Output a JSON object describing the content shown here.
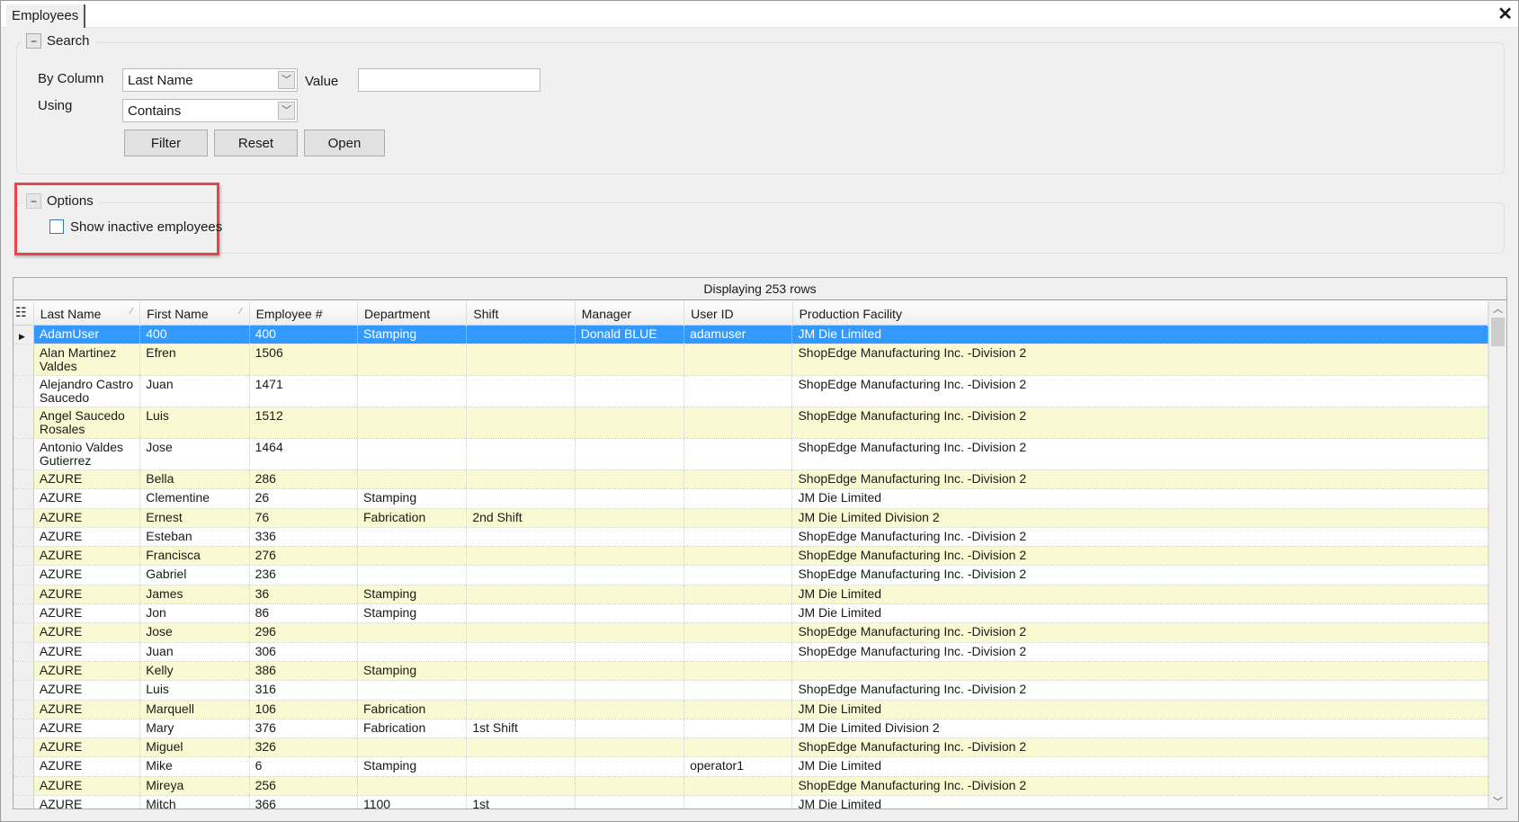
{
  "window": {
    "tab": "Employees",
    "close_icon": "close-icon"
  },
  "search": {
    "title": "Search",
    "by_column_label": "By Column",
    "by_column_value": "Last Name",
    "value_label": "Value",
    "value": "",
    "using_label": "Using",
    "using_value": "Contains",
    "filter": "Filter",
    "reset": "Reset",
    "open": "Open"
  },
  "options": {
    "title": "Options",
    "show_inactive": "Show inactive employees",
    "show_inactive_checked": false,
    "highlight_color": "#e8454a"
  },
  "grid": {
    "caption": "Displaying 253 rows",
    "columns": [
      "Last Name",
      "First Name",
      "Employee #",
      "Department",
      "Shift",
      "Manager",
      "User ID",
      "Production Facility"
    ],
    "selected_color": "#3399ff",
    "alt_row_color": "#fafad2",
    "rows": [
      [
        "AdamUser",
        "400",
        "400",
        "Stamping",
        "",
        "Donald BLUE",
        "adamuser",
        "JM Die Limited"
      ],
      [
        "Alan Martinez Valdes",
        "Efren",
        "1506",
        "",
        "",
        "",
        "",
        "ShopEdge Manufacturing Inc. -Division 2"
      ],
      [
        "Alejandro Castro Saucedo",
        "Juan",
        "1471",
        "",
        "",
        "",
        "",
        "ShopEdge Manufacturing Inc. -Division 2"
      ],
      [
        "Angel Saucedo Rosales",
        "Luis",
        "1512",
        "",
        "",
        "",
        "",
        "ShopEdge Manufacturing Inc. -Division 2"
      ],
      [
        "Antonio Valdes Gutierrez",
        "Jose",
        "1464",
        "",
        "",
        "",
        "",
        "ShopEdge Manufacturing Inc. -Division 2"
      ],
      [
        "AZURE",
        "Bella",
        "286",
        "",
        "",
        "",
        "",
        "ShopEdge Manufacturing Inc. -Division 2"
      ],
      [
        "AZURE",
        "Clementine",
        "26",
        "Stamping",
        "",
        "",
        "",
        "JM Die Limited"
      ],
      [
        "AZURE",
        "Ernest",
        "76",
        "Fabrication",
        "2nd Shift",
        "",
        "",
        "JM Die Limited Division 2"
      ],
      [
        "AZURE",
        "Esteban",
        "336",
        "",
        "",
        "",
        "",
        "ShopEdge Manufacturing Inc. -Division 2"
      ],
      [
        "AZURE",
        "Francisca",
        "276",
        "",
        "",
        "",
        "",
        "ShopEdge Manufacturing Inc. -Division 2"
      ],
      [
        "AZURE",
        "Gabriel",
        "236",
        "",
        "",
        "",
        "",
        "ShopEdge Manufacturing Inc. -Division 2"
      ],
      [
        "AZURE",
        "James",
        "36",
        "Stamping",
        "",
        "",
        "",
        "JM Die Limited"
      ],
      [
        "AZURE",
        "Jon",
        "86",
        "Stamping",
        "",
        "",
        "",
        "JM Die Limited"
      ],
      [
        "AZURE",
        "Jose",
        "296",
        "",
        "",
        "",
        "",
        "ShopEdge Manufacturing Inc. -Division 2"
      ],
      [
        "AZURE",
        "Juan",
        "306",
        "",
        "",
        "",
        "",
        "ShopEdge Manufacturing Inc. -Division 2"
      ],
      [
        "AZURE",
        "Kelly",
        "386",
        "Stamping",
        "",
        "",
        "",
        ""
      ],
      [
        "AZURE",
        "Luis",
        "316",
        "",
        "",
        "",
        "",
        "ShopEdge Manufacturing Inc. -Division 2"
      ],
      [
        "AZURE",
        "Marquell",
        "106",
        "Fabrication",
        "",
        "",
        "",
        "JM Die Limited"
      ],
      [
        "AZURE",
        "Mary",
        "376",
        "Fabrication",
        "1st Shift",
        "",
        "",
        "JM Die Limited Division 2"
      ],
      [
        "AZURE",
        "Miguel",
        "326",
        "",
        "",
        "",
        "",
        "ShopEdge Manufacturing Inc. -Division 2"
      ],
      [
        "AZURE",
        "Mike",
        "6",
        "Stamping",
        "",
        "",
        "operator1",
        "JM Die Limited"
      ],
      [
        "AZURE",
        "Mireya",
        "256",
        "",
        "",
        "",
        "",
        "ShopEdge Manufacturing Inc. -Division 2"
      ],
      [
        "AZURE",
        "Mitch",
        "366",
        "1100",
        "1st",
        "",
        "",
        "JM Die Limited"
      ]
    ]
  }
}
